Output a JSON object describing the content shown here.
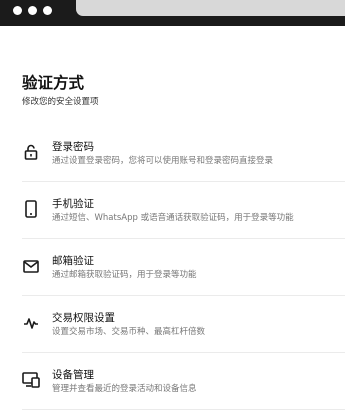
{
  "header": {
    "title": "验证方式",
    "subtitle": "修改您的安全设置项"
  },
  "items": [
    {
      "label": "登录密码",
      "desc": "通过设置登录密码，您将可以使用账号和登录密码直接登录",
      "icon": "lock-icon"
    },
    {
      "label": "手机验证",
      "desc": "通过短信、WhatsApp 或语音通话获取验证码，用于登录等功能",
      "icon": "phone-icon"
    },
    {
      "label": "邮箱验证",
      "desc": "通过邮箱获取验证码，用于登录等功能",
      "icon": "mail-icon"
    },
    {
      "label": "交易权限设置",
      "desc": "设置交易市场、交易币种、最高杠杆倍数",
      "icon": "activity-icon"
    },
    {
      "label": "设备管理",
      "desc": "管理并查看最近的登录活动和设备信息",
      "icon": "devices-icon"
    }
  ]
}
